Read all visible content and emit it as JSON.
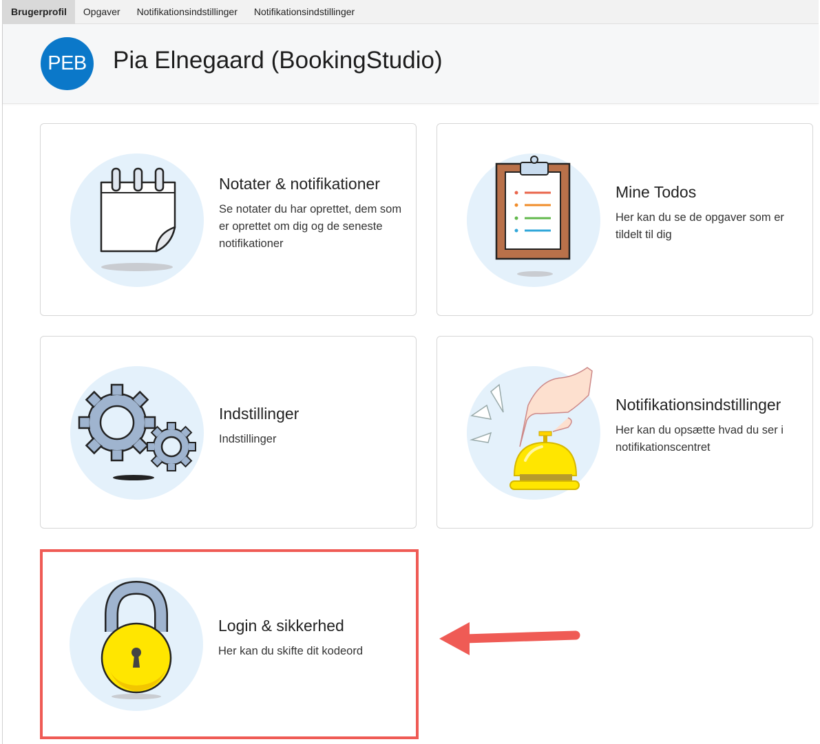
{
  "tabs": [
    "Brugerprofil",
    "Opgaver",
    "Notifikationsindstillinger",
    "Notifikationsindstillinger"
  ],
  "header": {
    "avatar_initials": "PEB",
    "user_name": "Pia Elnegaard (BookingStudio)"
  },
  "cards": [
    {
      "title": "Notater & notifikationer",
      "description": "Se notater du har oprettet, dem som er oprettet om dig og de seneste notifikationer",
      "icon": "notepad-icon"
    },
    {
      "title": "Mine Todos",
      "description": "Her kan du se de opgaver som er tildelt til dig",
      "icon": "clipboard-icon"
    },
    {
      "title": "Indstillinger",
      "description": "Indstillinger",
      "icon": "gears-icon"
    },
    {
      "title": "Notifikationsindstillinger",
      "description": "Her kan du opsætte hvad du ser i notifikationscentret",
      "icon": "service-bell-icon"
    },
    {
      "title": "Login & sikkerhed",
      "description": "Her kan du skifte dit kodeord",
      "icon": "padlock-icon"
    }
  ],
  "colors": {
    "avatar": "#0b78c9",
    "highlight": "#ef5b55",
    "icon_bg": "#e4f1fb",
    "lock_yellow": "#ffe600"
  }
}
